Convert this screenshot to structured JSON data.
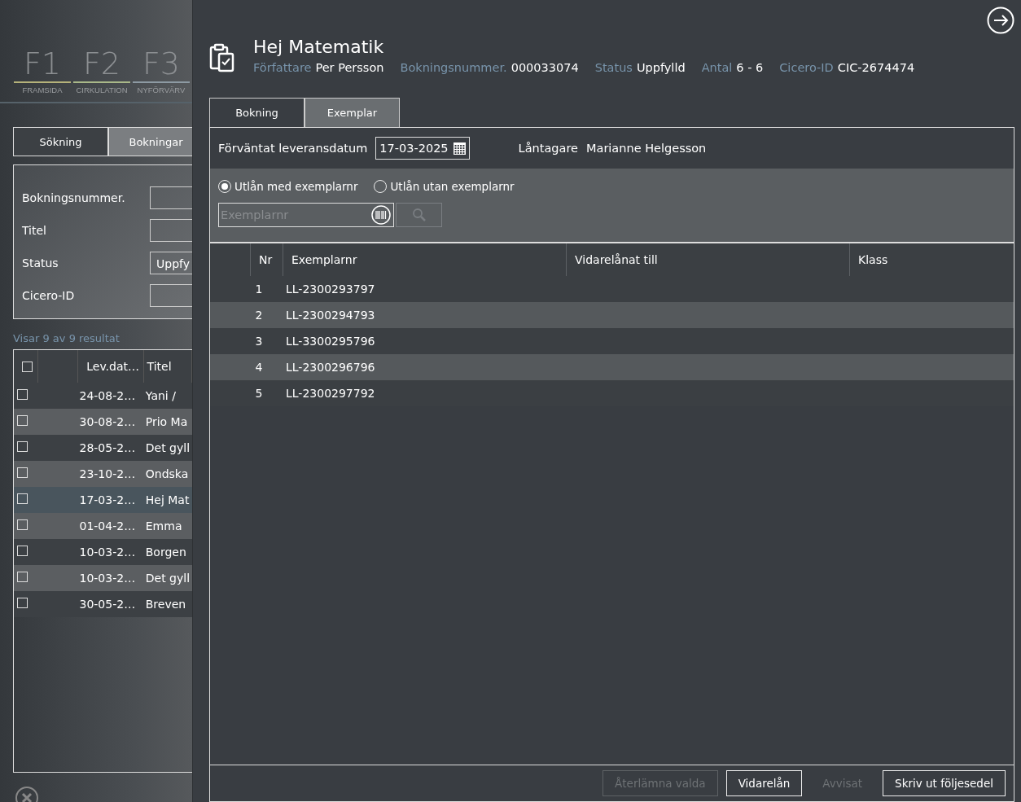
{
  "nav": [
    {
      "key": "F1",
      "label": "FRAMSIDA",
      "color": "#b5b27a"
    },
    {
      "key": "F2",
      "label": "CIRKULATION",
      "color": "#a9b889"
    },
    {
      "key": "F3",
      "label": "NYFÖRVÄRV",
      "color": "#8d9aa3"
    }
  ],
  "side_tabs": [
    {
      "label": "Sökning",
      "selected": false
    },
    {
      "label": "Bokningar",
      "selected": true
    }
  ],
  "search_form": [
    {
      "label": "Bokningsnummer."
    },
    {
      "label": "Titel"
    },
    {
      "label": "Status",
      "value": "Uppfy"
    },
    {
      "label": "Cicero-ID"
    }
  ],
  "results_text": "Visar 9 av 9 resultat",
  "results": {
    "all_checked": false,
    "columns": [
      "Lev.dat…",
      "Titel"
    ],
    "rows": [
      {
        "checked": false,
        "selected": false,
        "date": "24-08-2…",
        "title": "Yani /"
      },
      {
        "checked": false,
        "selected": false,
        "date": "30-08-2…",
        "title": "Prio Ma"
      },
      {
        "checked": false,
        "selected": false,
        "date": "28-05-2…",
        "title": "Det gyll"
      },
      {
        "checked": false,
        "selected": false,
        "date": "23-10-2…",
        "title": "Ondska"
      },
      {
        "checked": false,
        "selected": true,
        "date": "17-03-2…",
        "title": "Hej Mat"
      },
      {
        "checked": false,
        "selected": false,
        "date": "01-04-2…",
        "title": "Emma"
      },
      {
        "checked": false,
        "selected": false,
        "date": "10-03-2…",
        "title": "Borgen"
      },
      {
        "checked": false,
        "selected": false,
        "date": "10-03-2…",
        "title": "Det gyll"
      },
      {
        "checked": false,
        "selected": false,
        "date": "30-05-2…",
        "title": "Breven"
      }
    ]
  },
  "booking": {
    "title": "Hej Matematik",
    "meta": [
      {
        "label": "Författare",
        "value": "Per Persson"
      },
      {
        "label": "Bokningsnummer.",
        "value": "000033074"
      },
      {
        "label": "Status",
        "value": "Uppfylld"
      },
      {
        "label": "Antal",
        "value": "6 - 6"
      },
      {
        "label": "Cicero-ID",
        "value": "CIC-2674474"
      }
    ],
    "tabs": [
      {
        "label": "Bokning",
        "selected": false
      },
      {
        "label": "Exemplar",
        "selected": true
      }
    ],
    "delivery_label": "Förväntat leveransdatum",
    "delivery_date": "17-03-2025",
    "borrower_label": "Låntagare",
    "borrower": "Marianne Helgesson",
    "loan_options": [
      {
        "label": "Utlån med exemplarnr",
        "selected": true
      },
      {
        "label": "Utlån utan exemplarnr",
        "selected": false
      }
    ],
    "copy_search": {
      "placeholder": "Exemplarnr"
    },
    "table": {
      "columns": [
        "Nr",
        "Exemplarnr",
        "Vidarelånat till",
        "Klass"
      ],
      "rows": [
        {
          "nr": "1",
          "copy": "LL-2300293797"
        },
        {
          "nr": "2",
          "copy": "LL-2300294793"
        },
        {
          "nr": "3",
          "copy": "LL-3300295796"
        },
        {
          "nr": "4",
          "copy": "LL-2300296796"
        },
        {
          "nr": "5",
          "copy": "LL-2300297792"
        }
      ]
    },
    "buttons": [
      {
        "label": "Återlämna valda",
        "disabled": true,
        "kind": "outlined"
      },
      {
        "label": "Vidarelån",
        "disabled": false,
        "kind": "outlined"
      },
      {
        "label": "Avvisat",
        "disabled": true,
        "kind": "flat"
      },
      {
        "label": "Skriv ut följesedel",
        "disabled": false,
        "kind": "outlined"
      }
    ]
  }
}
